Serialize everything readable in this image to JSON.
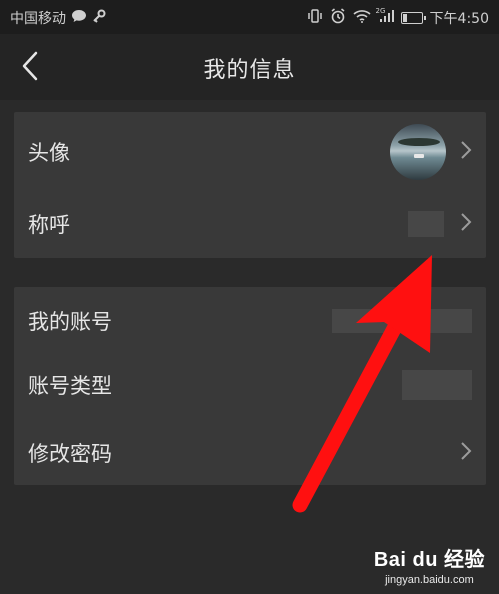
{
  "status_bar": {
    "carrier": "中国移动",
    "time": "下午4:50",
    "network_badge": "2G",
    "battery_level": 0.25,
    "icons": [
      "chat-bubble-icon",
      "key-icon",
      "vibrate-icon",
      "alarm-icon",
      "wifi-icon",
      "signal-icon",
      "battery-icon"
    ]
  },
  "header": {
    "title": "我的信息",
    "back_icon": "back-chevron-icon"
  },
  "profile_section": {
    "avatar_label": "头像",
    "nickname_label": "称呼"
  },
  "account_section": {
    "account_label": "我的账号",
    "account_type_label": "账号类型",
    "change_password_label": "修改密码"
  },
  "annotation": {
    "arrow_color": "#ff1010"
  },
  "watermark": {
    "logo": "Bai du 经验",
    "url": "jingyan.baidu.com"
  }
}
